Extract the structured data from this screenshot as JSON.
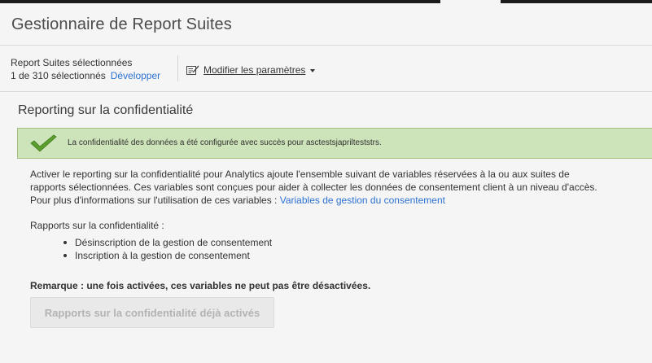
{
  "header": {
    "title": "Gestionnaire de Report Suites"
  },
  "report_suites": {
    "label": "Report Suites sélectionnées",
    "count": "1 de 310 sélectionnés",
    "expand_link": "Développer"
  },
  "toolbar": {
    "modify_label": "Modifier les paramètres"
  },
  "section": {
    "title": "Reporting sur la confidentialité",
    "success_message": "La confidentialité des données a été configurée avec succès pour asctestsjaprilteststrs.",
    "description_line1": "Activer le reporting sur la confidentialité pour Analytics ajoute l'ensemble suivant de variables réservées à la ou aux suites de",
    "description_line2": "rapports sélectionnées. Ces variables sont conçues pour aider à collecter les données de consentement client à un niveau d'accès.",
    "description_line3": "Pour plus d'informations sur l'utilisation de ces variables : ",
    "description_link": "Variables de gestion du consentement",
    "reports_label": "Rapports sur la confidentialité :",
    "reports": [
      "Désinscription de la gestion de consentement",
      "Inscription à la gestion de consentement"
    ],
    "remark": "Remarque : une fois activées, ces variables ne peut pas être désactivées.",
    "activate_button": "Rapports sur la confidentialité déjà activés"
  },
  "colors": {
    "success_bg": "#cde3b9",
    "success_border": "#9ec283",
    "link": "#2d72d2",
    "check": "#5a9e2e"
  },
  "icons": {
    "edit": "edit-icon",
    "check": "checkmark-icon",
    "dropdown": "chevron-down-icon"
  }
}
